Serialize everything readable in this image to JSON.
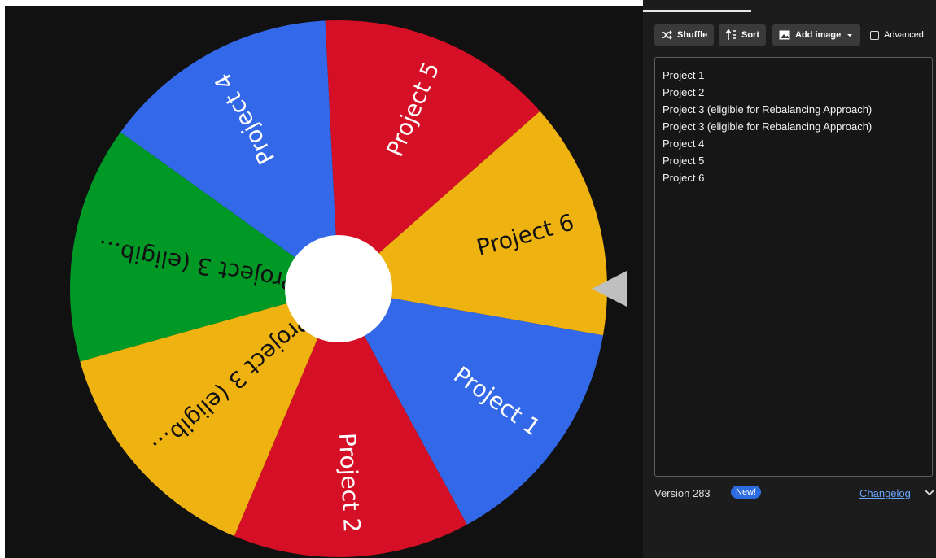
{
  "wheel": {
    "segments": [
      {
        "label": "Project 1",
        "color": "#3369e8",
        "text_color": "#ffffff"
      },
      {
        "label": "Project 2",
        "color": "#d50f25",
        "text_color": "#ffffff"
      },
      {
        "label": "Project 3 (eligib…",
        "color": "#eeb211",
        "text_color": "#111111"
      },
      {
        "label": "Project 3 (eligib…",
        "color": "#009925",
        "text_color": "#111111"
      },
      {
        "label": "Project 4",
        "color": "#3369e8",
        "text_color": "#ffffff"
      },
      {
        "label": "Project 5",
        "color": "#d50f25",
        "text_color": "#ffffff"
      },
      {
        "label": "Project 6",
        "color": "#eeb211",
        "text_color": "#111111"
      }
    ],
    "center_color": "#ffffff",
    "pointer_color": "#bfbfbf"
  },
  "toolbar": {
    "shuffle_label": "Shuffle",
    "sort_label": "Sort",
    "add_image_label": "Add image",
    "advanced_label": "Advanced"
  },
  "entries": [
    "Project 1",
    "Project 2",
    "Project 3 (eligible for Rebalancing Approach)",
    "Project 3 (eligible for Rebalancing Approach)",
    "Project 4",
    "Project 5",
    "Project 6"
  ],
  "footer": {
    "version": "Version 283",
    "new_badge": "New!",
    "changelog": "Changelog"
  }
}
